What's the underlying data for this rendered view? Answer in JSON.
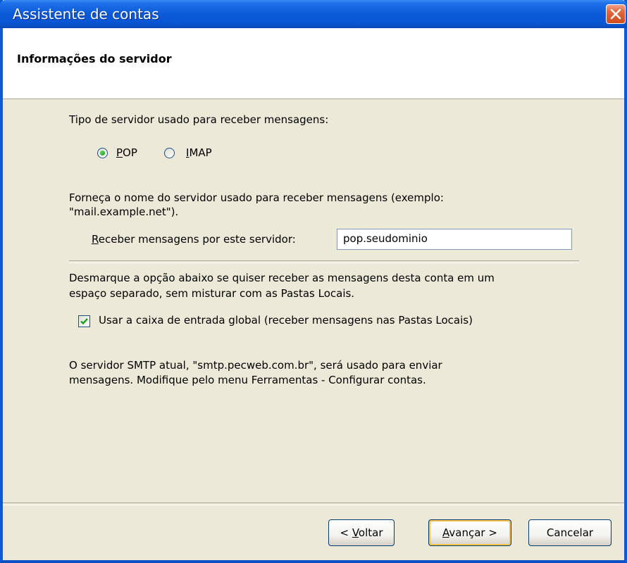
{
  "window": {
    "title": "Assistente de contas"
  },
  "header": {
    "title": "Informações do servidor"
  },
  "server_type": {
    "label": "Tipo de servidor usado para receber mensagens:",
    "options": [
      {
        "label_first": "P",
        "label_rest": "OP",
        "selected": true
      },
      {
        "label_first": "I",
        "label_rest": "MAP",
        "selected": false
      }
    ]
  },
  "server_name": {
    "description_line1": "Forneça o nome do servidor usado para receber mensagens (exemplo:",
    "description_line2": "\"mail.example.net\").",
    "label_first": "R",
    "label_rest": "eceber mensagens por este servidor:",
    "value": "pop.seudominio"
  },
  "inbox": {
    "description_line1": "Desmarque a opção abaixo se quiser receber as mensagens desta conta em um",
    "description_line2": "espaço separado, sem misturar com as Pastas Locais.",
    "checkbox_label": "Usar a caixa de entrada global (receber mensagens nas Pastas Locais)",
    "checked": true
  },
  "smtp_note": {
    "line1": "O servidor SMTP atual, \"smtp.pecweb.com.br\", será usado para enviar",
    "line2": "mensagens. Modifique pelo menu Ferramentas - Configurar contas."
  },
  "buttons": {
    "back_prefix": "< ",
    "back_first": "V",
    "back_rest": "oltar",
    "next_first": "A",
    "next_rest": "vançar >",
    "cancel": "Cancelar"
  }
}
